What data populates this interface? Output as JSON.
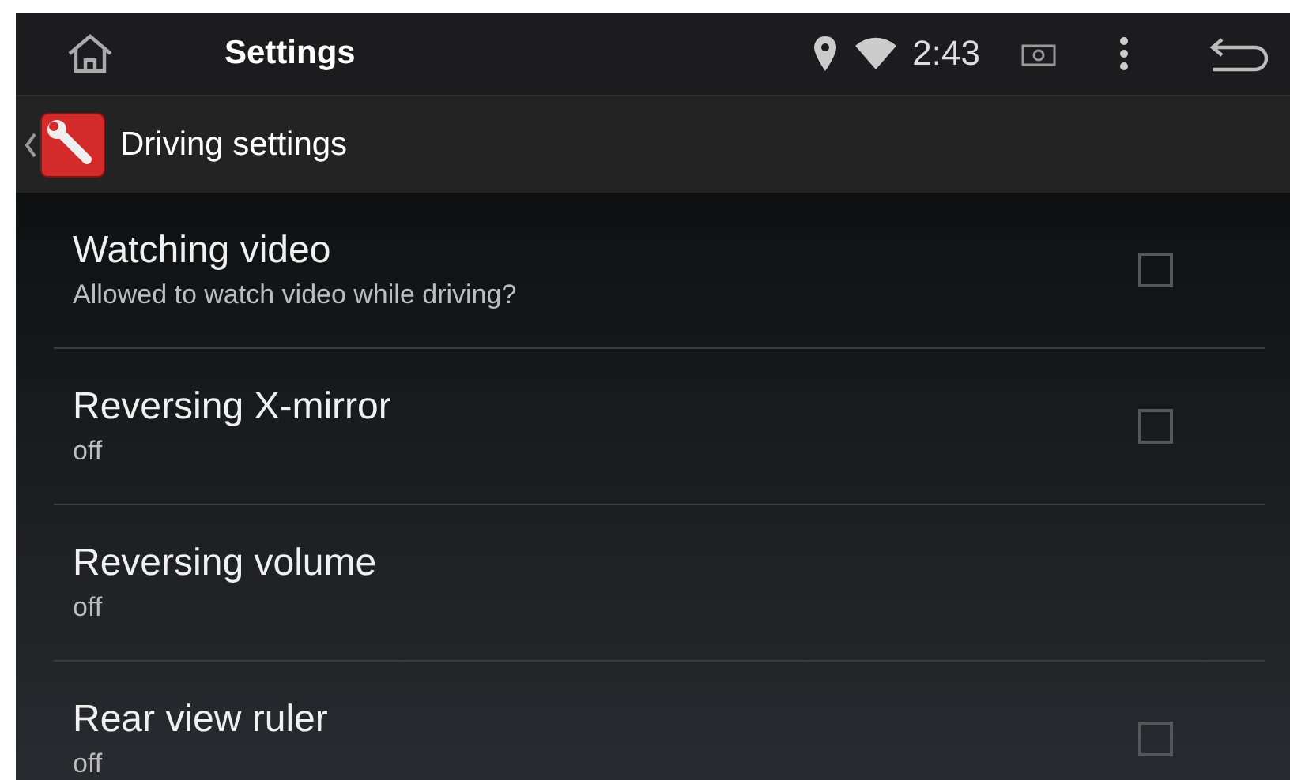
{
  "status_bar": {
    "title": "Settings",
    "time": "2:43"
  },
  "header": {
    "title": "Driving settings"
  },
  "items": [
    {
      "kind": "checkbox",
      "title": "Watching video",
      "summary": "Allowed to watch video while driving?",
      "checked": false
    },
    {
      "kind": "checkbox",
      "title": "Reversing X-mirror",
      "summary": "off",
      "checked": false
    },
    {
      "kind": "plain",
      "title": "Reversing volume",
      "summary": "off"
    },
    {
      "kind": "checkbox",
      "title": "Rear view ruler",
      "summary": "off",
      "checked": false
    }
  ]
}
